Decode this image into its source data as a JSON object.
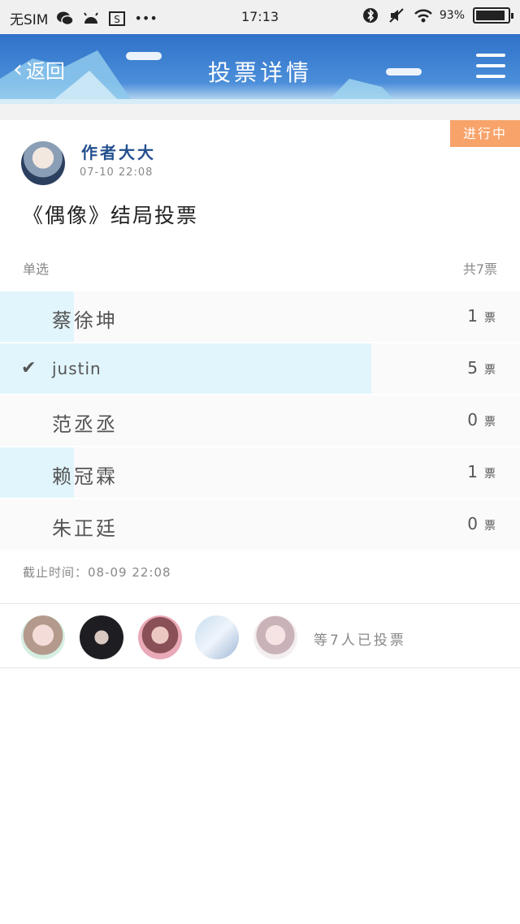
{
  "statusbar": {
    "carrier": "无SIM",
    "time": "17:13",
    "battery_percent": "93%",
    "battery_level": 0.93,
    "icons": [
      "wechat-icon",
      "android-icon",
      "s-app-icon",
      "more-dots-icon",
      "bluetooth-icon",
      "mute-icon",
      "wifi-icon",
      "battery-icon"
    ]
  },
  "header": {
    "back_label": "返回",
    "title": "投票详情",
    "menu_icon": "menu-icon",
    "background_color": "#3a7fd0"
  },
  "vote": {
    "status": "进行中",
    "status_color": "#f7a36a",
    "author": "作者大大",
    "time": "07-10 22:08",
    "title": "《偶像》结局投票",
    "type": "单选",
    "total": "共7票",
    "total_votes": 7,
    "options": [
      {
        "name": "蔡徐坤",
        "count": "1",
        "unit": "票",
        "votes": 1,
        "selected": false
      },
      {
        "name": "justin",
        "count": "5",
        "unit": "票",
        "votes": 5,
        "selected": true
      },
      {
        "name": "范丞丞",
        "count": "0",
        "unit": "票",
        "votes": 0,
        "selected": false
      },
      {
        "name": "赖冠霖",
        "count": "1",
        "unit": "票",
        "votes": 1,
        "selected": false
      },
      {
        "name": "朱正廷",
        "count": "0",
        "unit": "票",
        "votes": 0,
        "selected": false
      }
    ],
    "bar_color": "#e1f5fc",
    "deadline": "截止时间：08-09 22:08",
    "voters_summary": "等7人已投票",
    "voter_avatar_count": 5
  }
}
